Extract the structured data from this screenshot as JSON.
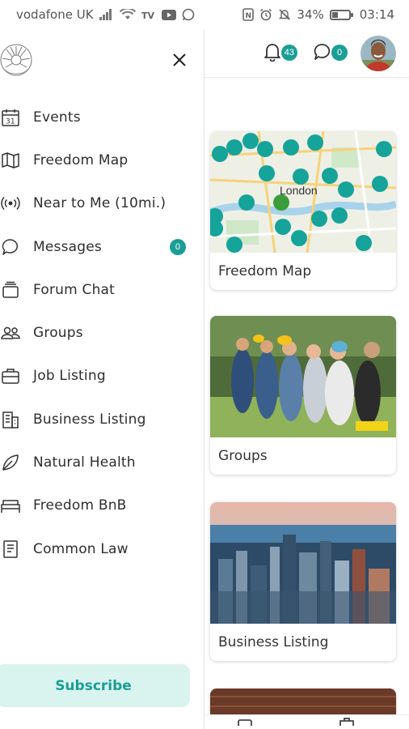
{
  "status_bar": {
    "carrier": "vodafone UK",
    "battery_percent": "34%",
    "battery_level": 0.34,
    "time": "03:14",
    "icons": [
      "signal-icon",
      "wifi-icon",
      "tv-icon",
      "youtube-icon",
      "whatsapp-icon",
      "nfc-icon",
      "alarm-icon",
      "mute-icon",
      "battery-icon"
    ]
  },
  "drawer": {
    "logo_icon": "freedom-logo-icon",
    "close_icon": "close-icon",
    "menu": [
      {
        "label": "Events",
        "icon": "calendar-icon"
      },
      {
        "label": "Freedom Map",
        "icon": "map-icon"
      },
      {
        "label": "Near to Me (10mi.)",
        "icon": "broadcast-icon"
      },
      {
        "label": "Messages",
        "icon": "chat-bubble-icon",
        "badge": "0"
      },
      {
        "label": "Forum Chat",
        "icon": "forum-icon"
      },
      {
        "label": "Groups",
        "icon": "groups-icon"
      },
      {
        "label": "Job Listing",
        "icon": "briefcase-icon"
      },
      {
        "label": "Business Listing",
        "icon": "building-icon"
      },
      {
        "label": "Natural Health",
        "icon": "leaf-icon"
      },
      {
        "label": "Freedom BnB",
        "icon": "bed-icon"
      },
      {
        "label": "Common Law",
        "icon": "document-icon"
      }
    ],
    "subscribe_label": "Subscribe"
  },
  "topbar": {
    "notifications_count": "43",
    "messages_count": "0"
  },
  "cards": [
    {
      "caption": "Freedom Map",
      "image": "map-thumbnail"
    },
    {
      "caption": "Groups",
      "image": "groups-photo"
    },
    {
      "caption": "Business Listing",
      "image": "city-skyline-photo"
    }
  ],
  "colors": {
    "accent": "#1a9e96",
    "subscribe_bg": "#d9f3ef",
    "subscribe_text": "#1a9e96",
    "text": "#2e2e2e"
  }
}
